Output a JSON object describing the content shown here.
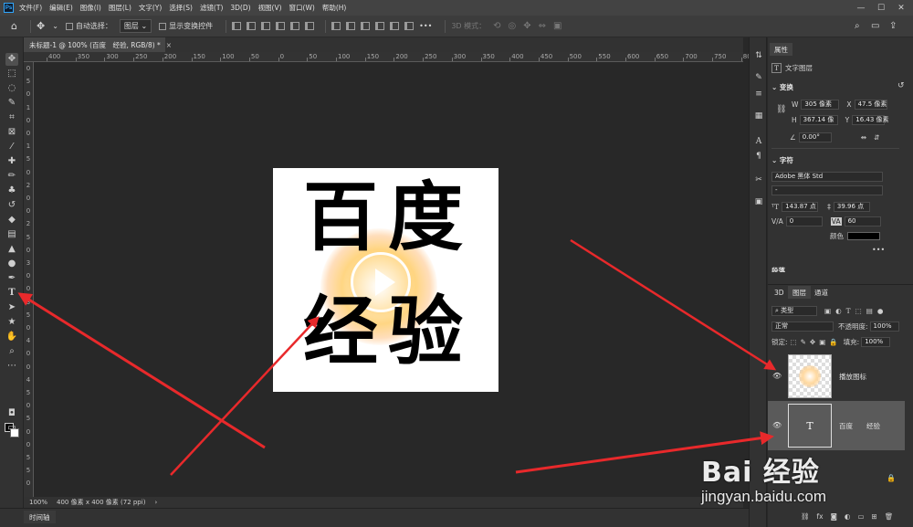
{
  "app": {
    "logo": "Ps"
  },
  "menu": [
    "文件(F)",
    "编辑(E)",
    "图像(I)",
    "图层(L)",
    "文字(Y)",
    "选择(S)",
    "滤镜(T)",
    "3D(D)",
    "视图(V)",
    "窗口(W)",
    "帮助(H)"
  ],
  "window_controls": {
    "minimize": "—",
    "maximize": "☐",
    "close": "✕"
  },
  "options_bar": {
    "auto_select_label": "自动选择：",
    "auto_select_value": "图层",
    "show_transform_label": "显示变换控件",
    "mode_3d_label": "3D 模式：",
    "more": "•••"
  },
  "document_tab": {
    "title": "未标题-1 @ 100% (百度　经验, RGB/8) *",
    "close": "×"
  },
  "ruler_top_labels": [
    "400",
    "350",
    "300",
    "250",
    "200",
    "150",
    "100",
    "50",
    "0",
    "50",
    "100",
    "150",
    "200",
    "250",
    "300",
    "350",
    "400",
    "450",
    "500",
    "550",
    "600",
    "650",
    "700",
    "750",
    "800"
  ],
  "ruler_left_labels": [
    "0",
    "5",
    "0",
    "1",
    "0",
    "0",
    "1",
    "5",
    "0",
    "2",
    "0",
    "0",
    "2",
    "5",
    "0",
    "3",
    "0",
    "0",
    "3",
    "5",
    "0",
    "4",
    "0",
    "0",
    "4",
    "5",
    "0",
    "5",
    "0",
    "0",
    "5",
    "5",
    "0"
  ],
  "canvas_text": {
    "line1_char1": "百",
    "line1_char2": "度",
    "line2_char1": "经",
    "line2_char2": "验"
  },
  "status_bar": {
    "zoom": "100%",
    "doc_info": "400 像素 x 400 像素 (72 ppi)",
    "arrow": "›"
  },
  "timeline_tab": "时间轴",
  "properties_panel": {
    "tab": "属性",
    "layer_type": "文字图层",
    "transform_title": "变换",
    "w_label": "W",
    "w_value": "305 像素",
    "x_label": "X",
    "x_value": "47.5 像素",
    "h_label": "H",
    "h_value": "367.14 像",
    "y_label": "Y",
    "y_value": "16.43 像素",
    "angle_value": "0.00°",
    "char_title": "字符",
    "font_family": "Adobe 黑体 Std",
    "font_style": "-",
    "font_size": "143.87 点",
    "leading": "39.96 点",
    "kerning": "0",
    "tracking": "60",
    "color_label": "颜色",
    "more": "•••",
    "paragraph_title": "段落"
  },
  "layers_panel": {
    "tabs": [
      "3D",
      "图层",
      "通道"
    ],
    "filter_label": "类型",
    "blend_mode": "正常",
    "opacity_label": "不透明度:",
    "opacity_value": "100%",
    "lock_label": "锁定:",
    "fill_label": "填充:",
    "fill_value": "100%",
    "layers": [
      {
        "name": "播放图标",
        "visible": true,
        "type": "image"
      },
      {
        "name": "百度　　经验",
        "visible": true,
        "type": "text",
        "thumb_glyph": "T"
      }
    ],
    "bottom_icons": [
      "link-icon",
      "fx-icon",
      "mask-icon",
      "adjustment-icon",
      "group-icon",
      "new-layer-icon",
      "delete-icon"
    ]
  },
  "colors": {
    "accent": "#31a8ff",
    "arrow": "#e8292b",
    "fg_color": "#000000",
    "bg_color": "#ffffff",
    "text_color_swatch": "#000000"
  },
  "watermark": {
    "logo": "Bai 经验",
    "url": "jingyan.baidu.com"
  }
}
